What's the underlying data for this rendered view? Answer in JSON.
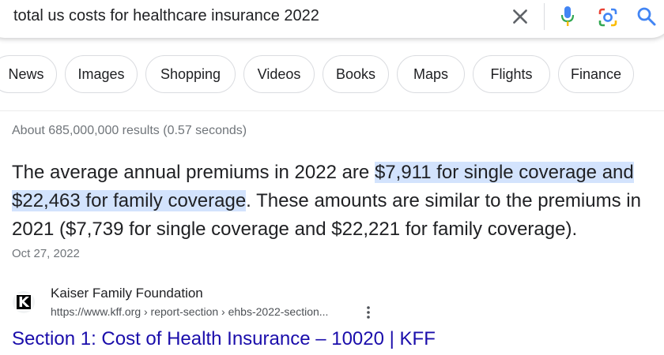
{
  "search": {
    "query": "total us costs for healthcare insurance 2022",
    "icons": [
      "close-icon",
      "mic-icon",
      "lens-icon",
      "search-icon"
    ]
  },
  "tabs": [
    "News",
    "Images",
    "Shopping",
    "Videos",
    "Books",
    "Maps",
    "Flights",
    "Finance"
  ],
  "stats": "About 685,000,000 results (0.57 seconds)",
  "snippet": {
    "before": "The average annual premiums in 2022 are ",
    "highlight": "$7,911 for single coverage and $22,463 for family coverage",
    "after": ". These amounts are similar to the premiums in 2021 ($7,739 for single coverage and $22,221 for family coverage).",
    "date": "Oct 27, 2022",
    "highlight_color": "#d3e3fd"
  },
  "result": {
    "favicon_letter": "K",
    "site_name": "Kaiser Family Foundation",
    "url": "https://www.kff.org › report-section › ehbs-2022-section...",
    "title": "Section 1: Cost of Health Insurance – 10020 | KFF",
    "title_color": "#1a0dab"
  }
}
